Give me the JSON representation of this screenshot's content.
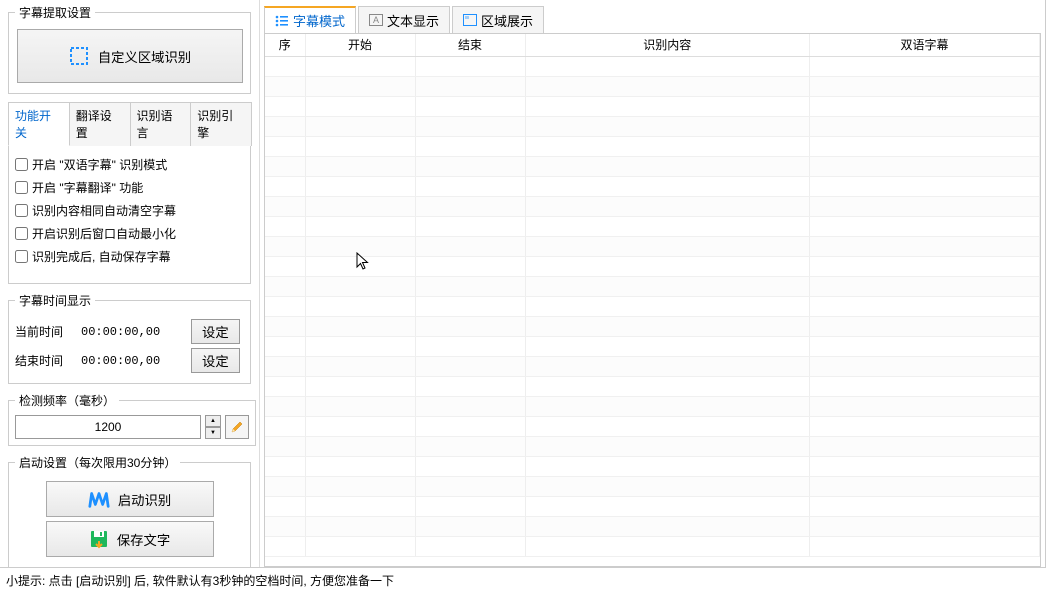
{
  "left": {
    "fieldset_title": "字幕提取设置",
    "custom_region_btn": "自定义区域识别",
    "tabs": [
      "功能开关",
      "翻译设置",
      "识别语言",
      "识别引擎"
    ],
    "checks": [
      "开启 \"双语字幕\" 识别模式",
      "开启 \"字幕翻译\" 功能",
      "识别内容相同自动清空字幕",
      "开启识别后窗口自动最小化",
      "识别完成后, 自动保存字幕"
    ],
    "time_fieldset": "字幕时间显示",
    "current_time_label": "当前时间",
    "current_time_value": "00:00:00,00",
    "end_time_label": "结束时间",
    "end_time_value": "00:00:00,00",
    "set_btn": "设定",
    "freq_fieldset": "检测频率（毫秒）",
    "freq_value": "1200",
    "launch_fieldset": "启动设置（每次限用30分钟）",
    "start_btn": "启动识别",
    "save_btn": "保存文字"
  },
  "right": {
    "tabs": [
      "字幕模式",
      "文本显示",
      "区域展示"
    ],
    "headers": {
      "seq": "序",
      "start": "开始",
      "end": "结束",
      "content": "识别内容",
      "bilingual": "双语字幕"
    }
  },
  "footer": "小提示: 点击 [启动识别] 后, 软件默认有3秒钟的空档时间, 方便您准备一下"
}
